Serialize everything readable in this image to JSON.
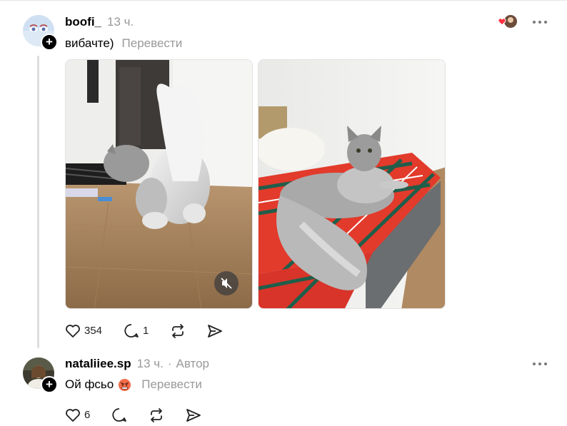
{
  "post": {
    "username": "boofi_",
    "time": "13 ч.",
    "text": "вибачте)",
    "translate_label": "Перевести",
    "likes": "354",
    "comments": "1"
  },
  "reply": {
    "username": "nataliiee.sp",
    "time": "13 ч.",
    "separator": "·",
    "author_label": "Автор",
    "text": "Ой фсьо",
    "translate_label": "Перевести",
    "likes": "6"
  },
  "icons": {
    "like": "heart-icon",
    "comment": "comment-icon",
    "repost": "repost-icon",
    "share": "send-icon",
    "more": "more-dots-icon",
    "mute": "muted-speaker-icon",
    "plus": "plus-icon"
  },
  "colors": {
    "text_secondary": "#999999",
    "accent_like": "#ff3040"
  }
}
